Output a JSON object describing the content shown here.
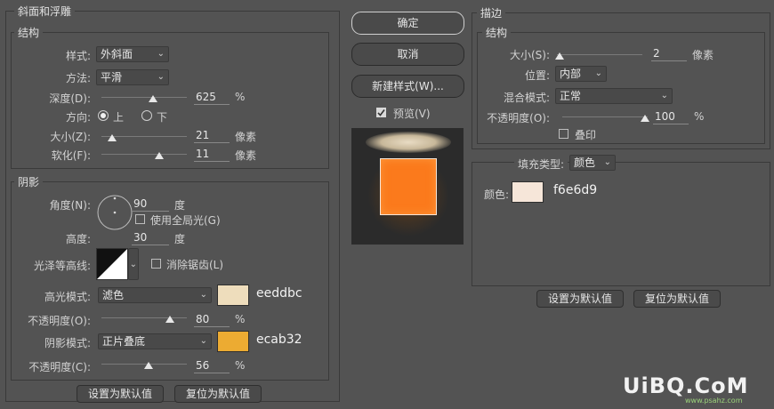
{
  "bevel": {
    "title": "斜面和浮雕",
    "structure": {
      "title": "结构",
      "style_label": "样式:",
      "style_value": "外斜面",
      "technique_label": "方法:",
      "technique_value": "平滑",
      "depth_label": "深度(D):",
      "depth_value": "625",
      "depth_unit": "%",
      "depth_level": 0.58,
      "direction_label": "方向:",
      "direction_up": "上",
      "direction_down": "下",
      "size_label": "大小(Z):",
      "size_value": "21",
      "size_unit": "像素",
      "size_level": 0.12,
      "soften_label": "软化(F):",
      "soften_value": "11",
      "soften_unit": "像素",
      "soften_level": 0.66
    },
    "shading": {
      "title": "阴影",
      "angle_label": "角度(N):",
      "angle_value": "90",
      "angle_unit": "度",
      "global_light_label": "使用全局光(G)",
      "altitude_label": "高度:",
      "altitude_value": "30",
      "altitude_unit": "度",
      "gloss_label": "光泽等高线:",
      "antialias_label": "消除锯齿(L)",
      "highlight_mode_label": "高光模式:",
      "highlight_mode_value": "滤色",
      "highlight_color": "#eeddbc",
      "highlight_hex": "eeddbc",
      "highlight_opacity_label": "不透明度(O):",
      "highlight_opacity_value": "80",
      "highlight_opacity_unit": "%",
      "highlight_opacity_level": 0.8,
      "shadow_mode_label": "阴影模式:",
      "shadow_mode_value": "正片叠底",
      "shadow_color": "#ecab32",
      "shadow_hex": "ecab32",
      "shadow_opacity_label": "不透明度(C):",
      "shadow_opacity_value": "56",
      "shadow_opacity_unit": "%",
      "shadow_opacity_level": 0.56
    },
    "set_default": "设置为默认值",
    "reset_default": "复位为默认值"
  },
  "middle": {
    "ok": "确定",
    "cancel": "取消",
    "new_style": "新建样式(W)...",
    "preview_label": "预览(V)"
  },
  "stroke": {
    "title": "描边",
    "structure_title": "结构",
    "size_label": "大小(S):",
    "size_value": "2",
    "size_unit": "像素",
    "size_level": 0.02,
    "position_label": "位置:",
    "position_value": "内部",
    "blend_label": "混合模式:",
    "blend_value": "正常",
    "opacity_label": "不透明度(O):",
    "opacity_value": "100",
    "opacity_unit": "%",
    "opacity_level": 1.0,
    "overprint_label": "叠印",
    "fill_type_label": "填充类型:",
    "fill_type_value": "颜色",
    "color_label": "颜色:",
    "color": "#f6e6d9",
    "color_hex": "f6e6d9",
    "set_default": "设置为默认值",
    "reset_default": "复位为默认值"
  },
  "watermark": {
    "text": "UiBQ.CoM",
    "sub": "www.psahz.com"
  }
}
